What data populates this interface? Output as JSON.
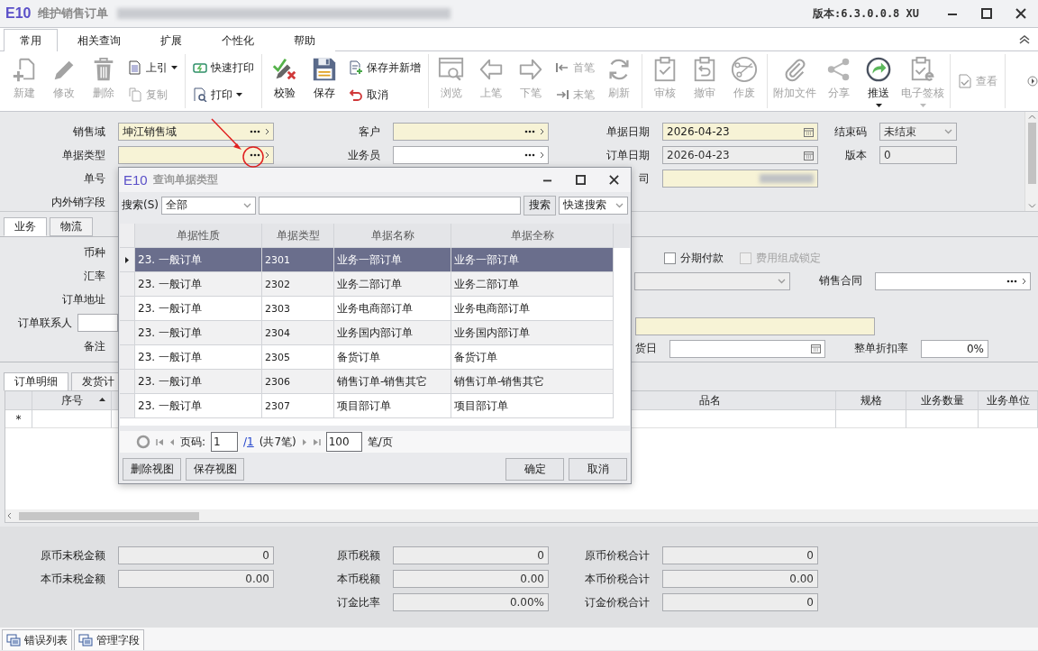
{
  "window": {
    "logo": "E10",
    "title": "维护销售订单",
    "redacted_subtitle": true,
    "version": "版本:6.3.0.0.8 XU"
  },
  "ribbon_tabs": [
    {
      "label": "常用",
      "selected": true
    },
    {
      "label": "相关查询",
      "selected": false
    },
    {
      "label": "扩展",
      "selected": false
    },
    {
      "label": "个性化",
      "selected": false
    },
    {
      "label": "帮助",
      "selected": false
    }
  ],
  "toolbar": [
    [
      {
        "kind": "large",
        "label": "新建",
        "disabled": true,
        "dropdown": false
      },
      {
        "kind": "large",
        "label": "修改",
        "disabled": true,
        "dropdown": false
      },
      {
        "kind": "large",
        "label": "删除",
        "disabled": true,
        "dropdown": false
      },
      {
        "kind": "pair",
        "items": [
          {
            "label": "上引",
            "disabled": false,
            "dropdown": true
          },
          {
            "label": "复制",
            "disabled": true,
            "dropdown": false
          }
        ]
      }
    ],
    [
      {
        "kind": "pair",
        "items": [
          {
            "label": "快速打印",
            "disabled": false,
            "dropdown": false
          },
          {
            "label": "打印",
            "disabled": false,
            "dropdown": true
          }
        ]
      }
    ],
    [
      {
        "kind": "large",
        "label": "校验",
        "disabled": false,
        "dropdown": false
      },
      {
        "kind": "large",
        "label": "保存",
        "disabled": false,
        "dropdown": false
      },
      {
        "kind": "pair",
        "items": [
          {
            "label": "保存并新增",
            "disabled": false,
            "dropdown": false
          },
          {
            "label": "取消",
            "disabled": false,
            "dropdown": false
          }
        ]
      }
    ],
    [
      {
        "kind": "large",
        "label": "浏览",
        "disabled": true,
        "dropdown": false
      },
      {
        "kind": "large",
        "label": "上笔",
        "disabled": true,
        "dropdown": false
      },
      {
        "kind": "large",
        "label": "下笔",
        "disabled": true,
        "dropdown": false
      },
      {
        "kind": "pair",
        "items": [
          {
            "label": "首笔",
            "disabled": true,
            "dropdown": false
          },
          {
            "label": "末笔",
            "disabled": true,
            "dropdown": false
          }
        ]
      },
      {
        "kind": "large",
        "label": "刷新",
        "disabled": true,
        "dropdown": false
      }
    ],
    [
      {
        "kind": "large",
        "label": "审核",
        "disabled": true,
        "dropdown": false
      },
      {
        "kind": "large",
        "label": "撤审",
        "disabled": true,
        "dropdown": false
      },
      {
        "kind": "large",
        "label": "作废",
        "disabled": true,
        "dropdown": false
      }
    ],
    [
      {
        "kind": "large",
        "label": "附加文件",
        "disabled": true,
        "dropdown": false
      },
      {
        "kind": "large",
        "label": "分享",
        "disabled": true,
        "dropdown": false
      },
      {
        "kind": "large",
        "label": "推送",
        "disabled": false,
        "dropdown": true
      },
      {
        "kind": "large",
        "label": "电子签核",
        "disabled": true,
        "dropdown": true
      }
    ],
    [
      {
        "kind": "pair",
        "items": [
          {
            "label": "查看",
            "disabled": true,
            "dropdown": false
          }
        ]
      }
    ]
  ],
  "header_columns": [
    [
      {
        "label": "销售域",
        "field": {
          "kind": "lookup",
          "value": "坤江销售域",
          "required": true,
          "readonly": false
        }
      },
      {
        "label": "单据类型",
        "field": {
          "kind": "lookup",
          "required": true,
          "readonly": false
        }
      },
      {
        "label": "单号"
      },
      {
        "label": "内外销字段"
      }
    ],
    [
      {
        "label": "客户",
        "field": {
          "kind": "lookup",
          "required": true,
          "readonly": false
        }
      },
      {
        "label": "业务员",
        "field": {
          "kind": "lookup",
          "required": false,
          "readonly": false
        }
      }
    ],
    [
      {
        "label": "单据日期",
        "field": {
          "kind": "date",
          "value": "2026-04-23",
          "required": true,
          "readonly": false
        }
      },
      {
        "label": "订单日期",
        "field": {
          "kind": "date",
          "value": "2026-04-23",
          "required": false,
          "readonly": true
        }
      },
      {
        "label": "司",
        "field": {
          "kind": "redacted",
          "required": true,
          "readonly": false
        }
      }
    ],
    [
      {
        "label": "结束码",
        "field": {
          "kind": "combo",
          "value": "未结束",
          "required": false,
          "readonly": true
        }
      },
      {
        "label": "版本",
        "field": {
          "kind": "text",
          "value": "0",
          "required": false,
          "readonly": true
        }
      }
    ]
  ],
  "section_tabs": [
    {
      "label": "业务",
      "selected": true
    },
    {
      "label": "物流",
      "selected": false
    }
  ],
  "business": {
    "left": [
      {
        "label": "币种"
      },
      {
        "label": "汇率"
      },
      {
        "label": "订单地址"
      },
      {
        "label": "订单联系人",
        "field": {
          "kind": "text",
          "required": false,
          "readonly": false
        }
      },
      {
        "label": "备注"
      }
    ],
    "right": [
      [
        {
          "kind": "checkbox",
          "label": "分期付款",
          "checked": false,
          "disabled": false
        },
        {
          "kind": "checkbox",
          "label": "费用组成锁定",
          "checked": false,
          "disabled": true
        }
      ],
      [
        {
          "kind": "combo",
          "required": false,
          "readonly": true
        },
        {
          "kind": "label",
          "label": "销售合同"
        },
        {
          "kind": "lookup",
          "required": false,
          "readonly": false
        }
      ],
      [
        {
          "kind": "text",
          "required": true,
          "readonly": false
        }
      ],
      [
        {
          "kind": "label",
          "label": "货日"
        },
        {
          "kind": "date",
          "required": false,
          "readonly": false
        },
        {
          "kind": "label",
          "label": "整单折扣率"
        },
        {
          "kind": "number",
          "value": "0%",
          "required": false,
          "readonly": false
        }
      ]
    ]
  },
  "detail_tabs": [
    {
      "label": "订单明细",
      "selected": true
    },
    {
      "label": "发货计",
      "selected": false
    }
  ],
  "detail_grid": {
    "columns": [
      {
        "label": "序号",
        "sorted_ascending": true
      },
      null,
      {
        "label": "品名"
      },
      {
        "label": "规格"
      },
      {
        "label": "业务数量"
      },
      {
        "label": "业务单位"
      }
    ],
    "new_row_marker": "*"
  },
  "totals": [
    [
      {
        "label": "原币未税金额",
        "value": "0"
      },
      {
        "label": "本币未税金额",
        "value": "0.00"
      }
    ],
    [
      {
        "label": "原币税额",
        "value": "0"
      },
      {
        "label": "本币税额",
        "value": "0.00"
      },
      {
        "label": "订金比率",
        "value": "0.00%"
      }
    ],
    [
      {
        "label": "原币价税合计",
        "value": "0"
      },
      {
        "label": "本币价税合计",
        "value": "0.00"
      },
      {
        "label": "订金价税合计",
        "value": "0"
      }
    ]
  ],
  "bottom_tabs": [
    {
      "label": "错误列表"
    },
    {
      "label": "管理字段"
    }
  ],
  "dialog": {
    "logo": "E10",
    "title": "查询单据类型",
    "search_label": "搜索(S)",
    "scope": "全部",
    "search_button": "搜索",
    "mode": "快速搜索",
    "columns": [
      "单据性质",
      "单据类型",
      "单据名称",
      "单据全称"
    ],
    "rows": [
      {
        "cells": [
          "23. 一般订单",
          "2301",
          "业务一部订单",
          "业务一部订单"
        ],
        "selected": true
      },
      {
        "cells": [
          "23. 一般订单",
          "2302",
          "业务二部订单",
          "业务二部订单"
        ],
        "selected": false
      },
      {
        "cells": [
          "23. 一般订单",
          "2303",
          "业务电商部订单",
          "业务电商部订单"
        ],
        "selected": false
      },
      {
        "cells": [
          "23. 一般订单",
          "2304",
          "业务国内部订单",
          "业务国内部订单"
        ],
        "selected": false
      },
      {
        "cells": [
          "23. 一般订单",
          "2305",
          "备货订单",
          "备货订单"
        ],
        "selected": false
      },
      {
        "cells": [
          "23. 一般订单",
          "2306",
          "销售订单-销售其它",
          "销售订单-销售其它"
        ],
        "selected": false
      },
      {
        "cells": [
          "23. 一般订单",
          "2307",
          "项目部订单",
          "项目部订单"
        ],
        "selected": false
      }
    ],
    "pager": {
      "page_label": "页码:",
      "page": "1",
      "separator": "/",
      "total_pages": "1",
      "count": "(共7笔)",
      "page_size": "100",
      "unit": "笔/页"
    },
    "buttons_left": [
      "删除视图",
      "保存视图"
    ],
    "buttons_right": [
      "确定",
      "取消"
    ]
  }
}
